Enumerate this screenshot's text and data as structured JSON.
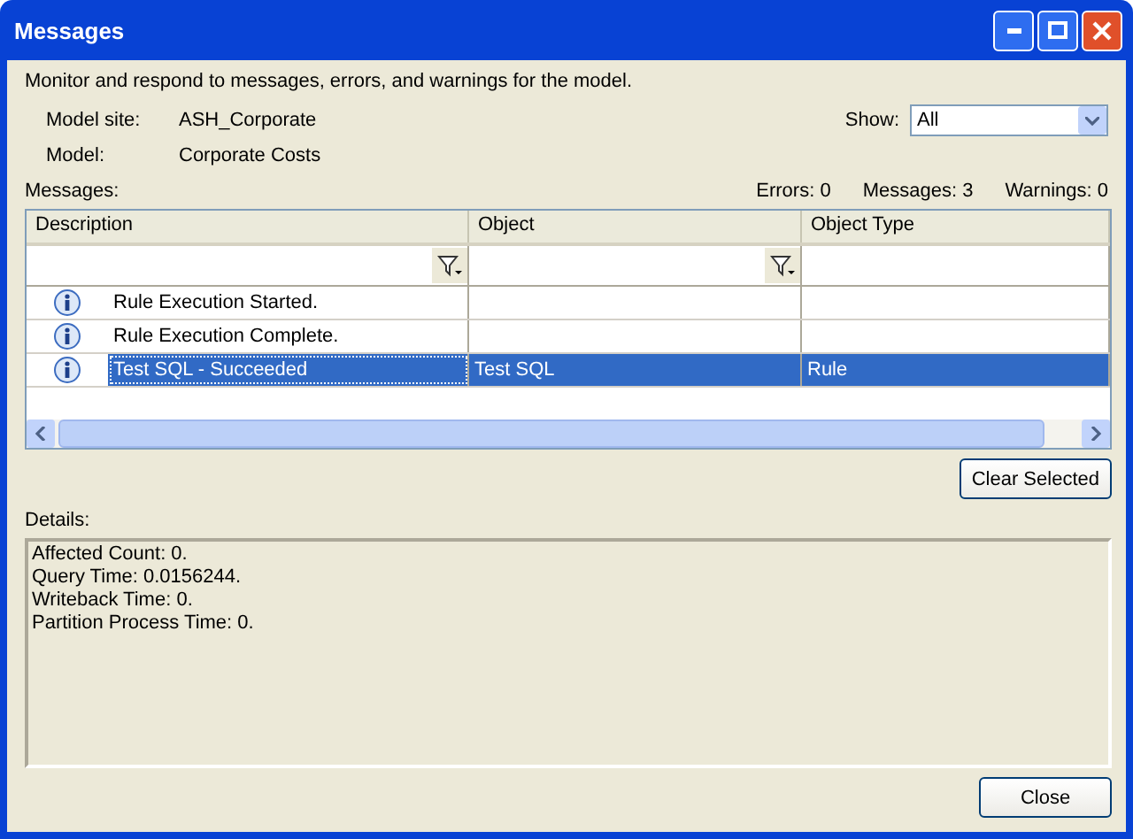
{
  "window": {
    "title": "Messages"
  },
  "intro": "Monitor and respond to messages, errors, and warnings for the model.",
  "info": [
    {
      "label": "Model site:",
      "value": "ASH_Corporate"
    },
    {
      "label": "Model:",
      "value": "Corporate Costs"
    }
  ],
  "show": {
    "label": "Show:",
    "value": "All"
  },
  "messages_label": "Messages:",
  "counts": [
    "Errors: 0",
    "Messages: 3",
    "Warnings: 0"
  ],
  "table": {
    "columns": [
      {
        "label": "Description",
        "filter": true
      },
      {
        "label": "Object",
        "filter": true
      },
      {
        "label": "Object Type",
        "filter": false
      }
    ],
    "rows": [
      {
        "cells": [
          "Rule Execution Started.",
          "",
          ""
        ],
        "selected": false
      },
      {
        "cells": [
          "Rule Execution Complete.",
          "",
          ""
        ],
        "selected": false
      },
      {
        "cells": [
          "Test SQL - Succeeded",
          "Test SQL",
          "Rule"
        ],
        "selected": true
      }
    ]
  },
  "clear_button": "Clear Selected",
  "details_label": "Details:",
  "details": [
    "Affected Count: 0.",
    "Query Time: 0.0156244.",
    "Writeback Time: 0.",
    "Partition Process Time: 0."
  ],
  "close_button": "Close"
}
